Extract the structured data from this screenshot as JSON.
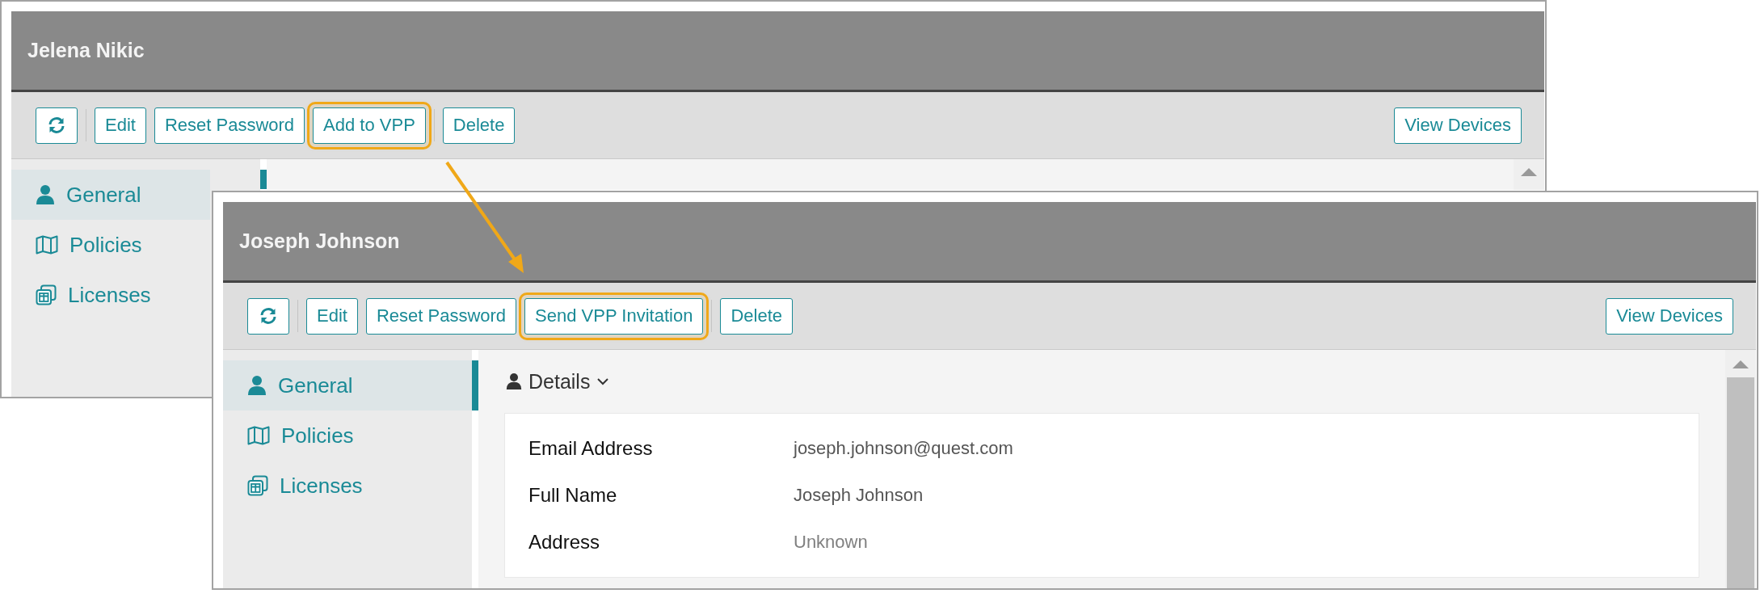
{
  "windows": [
    {
      "title": "Jelena Nikic",
      "buttons": [
        {
          "label": "Edit",
          "highlighted": false
        },
        {
          "label": "Reset Password",
          "highlighted": false
        },
        {
          "label": "Add to VPP",
          "highlighted": true
        },
        {
          "label": "Delete",
          "highlighted": false
        }
      ],
      "right_button": "View Devices",
      "sidebar": [
        {
          "label": "General",
          "selected": true
        },
        {
          "label": "Policies",
          "selected": false
        },
        {
          "label": "Licenses",
          "selected": false
        }
      ]
    },
    {
      "title": "Joseph Johnson",
      "buttons": [
        {
          "label": "Edit",
          "highlighted": false
        },
        {
          "label": "Reset Password",
          "highlighted": false
        },
        {
          "label": "Send VPP Invitation",
          "highlighted": true
        },
        {
          "label": "Delete",
          "highlighted": false
        }
      ],
      "right_button": "View Devices",
      "sidebar": [
        {
          "label": "General",
          "selected": true
        },
        {
          "label": "Policies",
          "selected": false
        },
        {
          "label": "Licenses",
          "selected": false
        }
      ],
      "section": {
        "title": "Details",
        "fields": [
          {
            "label": "Email Address",
            "value": "joseph.johnson@quest.com",
            "dimmed": false
          },
          {
            "label": "Full Name",
            "value": "Joseph Johnson",
            "dimmed": false
          },
          {
            "label": "Address",
            "value": "Unknown",
            "dimmed": true
          }
        ]
      }
    }
  ]
}
